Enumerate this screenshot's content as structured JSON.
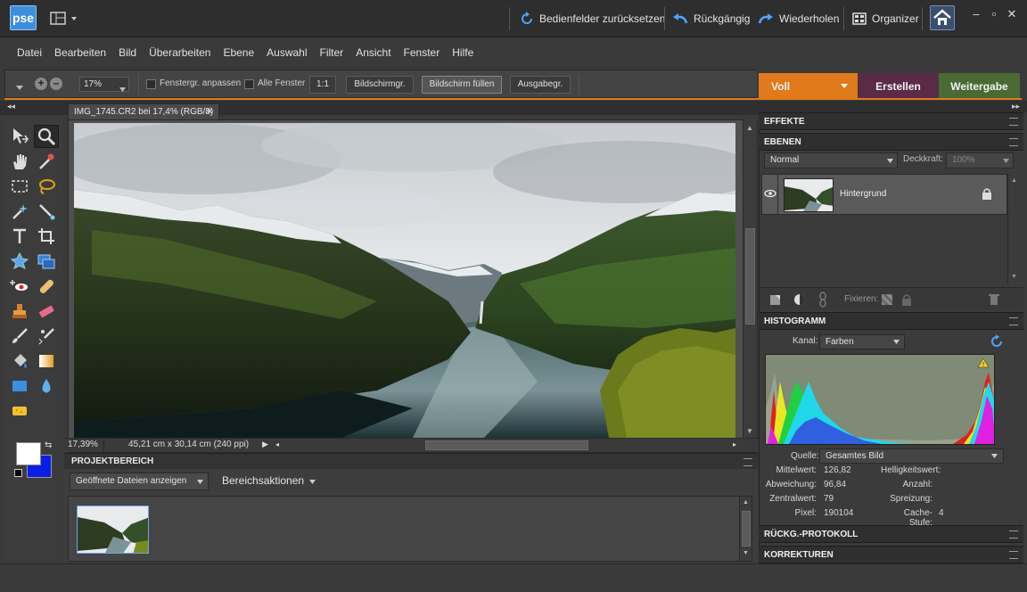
{
  "app": {
    "logo": "pse"
  },
  "titlebar": {
    "reset_panels": "Bedienfelder zurücksetzen",
    "undo": "Rückgängig",
    "redo": "Wiederholen",
    "organizer": "Organizer"
  },
  "menu": [
    "Datei",
    "Bearbeiten",
    "Bild",
    "Überarbeiten",
    "Ebene",
    "Auswahl",
    "Filter",
    "Ansicht",
    "Fenster",
    "Hilfe"
  ],
  "options": {
    "zoom": "17%",
    "fit_window_label": "Fenstergr. anpassen",
    "all_windows_label": "Alle Fenster",
    "btn_1to1": "1:1",
    "btn_screen_size": "Bildschirmgr.",
    "btn_fill_screen": "Bildschirm füllen",
    "btn_print_size": "Ausgabegr."
  },
  "mode_tabs": {
    "full": "Voll",
    "create": "Erstellen",
    "share": "Weitergabe"
  },
  "document": {
    "tab_title": "IMG_1745.CR2 bei 17,4% (RGB/8)",
    "status_zoom": "17,39%",
    "status_info": "45,21 cm x 30,14 cm (240 ppi)"
  },
  "project_bin": {
    "title": "PROJEKTBEREICH",
    "show_dropdown": "Geöffnete Dateien anzeigen",
    "actions": "Bereichsaktionen"
  },
  "panels": {
    "effects": "EFFEKTE",
    "layers": {
      "title": "EBENEN",
      "blend_mode": "Normal",
      "opacity_label": "Deckkraft:",
      "opacity_value": "100%",
      "layer_name": "Hintergrund",
      "lock_label": "Fixieren:"
    },
    "histogram": {
      "title": "HISTOGRAMM",
      "channel_label": "Kanal:",
      "channel_value": "Farben",
      "source_label": "Quelle:",
      "source_value": "Gesamtes Bild",
      "mean_label": "Mittelwert:",
      "mean_value": "126,82",
      "stddev_label": "Abweichung:",
      "stddev_value": "96,84",
      "median_label": "Zentralwert:",
      "median_value": "79",
      "pixels_label": "Pixel:",
      "pixels_value": "190104",
      "level_label": "Helligkeitswert:",
      "count_label": "Anzahl:",
      "percentile_label": "Spreizung:",
      "cache_label": "Cache-Stufe:",
      "cache_value": "4"
    },
    "history": "RÜCKG.-PROTOKOLL",
    "corrections": "KORREKTUREN"
  },
  "colors": {
    "accent_orange": "#e07a1a",
    "create_tab": "#5a2a46",
    "share_tab": "#4a6a34",
    "foreground": "#ffffff",
    "background": "#0a1ee6"
  }
}
